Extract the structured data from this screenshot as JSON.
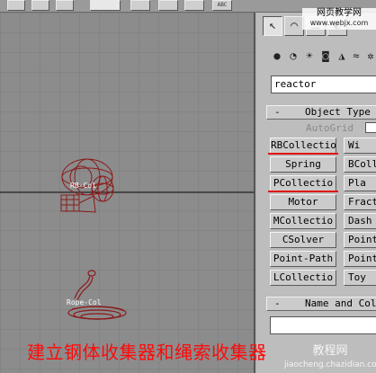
{
  "toolbar": {
    "abc_label": "ABC"
  },
  "panel": {
    "tabs": [
      {
        "icon": "create-icon",
        "glyph": "↖"
      },
      {
        "icon": "modify-icon",
        "glyph": "⌒"
      },
      {
        "icon": "hierarchy-icon",
        "glyph": "☰"
      },
      {
        "icon": "motion-icon",
        "glyph": "◐"
      }
    ],
    "categories": [
      {
        "icon": "geometry-icon",
        "glyph": "●"
      },
      {
        "icon": "shapes-icon",
        "glyph": "◔"
      },
      {
        "icon": "lights-icon",
        "glyph": "☀"
      },
      {
        "icon": "cameras-icon",
        "glyph": "◙"
      },
      {
        "icon": "helpers-icon",
        "glyph": "◮"
      },
      {
        "icon": "spacewarps-icon",
        "glyph": "≈"
      },
      {
        "icon": "systems-icon",
        "glyph": "✲"
      }
    ],
    "dropdown_value": "reactor",
    "object_type": {
      "sign": "-",
      "title": "Object Type",
      "autogrid": "AutoGrid"
    },
    "buttons_left": [
      "RBCollectio",
      "Spring",
      "PCollectio",
      "Motor",
      "MCollectio",
      "CSolver",
      "Point-Path",
      "LCollectio"
    ],
    "buttons_right": [
      "Wi",
      "BColl",
      "Pla",
      "Fract",
      "Dash",
      "Point",
      "Point-",
      "Toy"
    ],
    "name_color": {
      "sign": "-",
      "title": "Name and Colo"
    }
  },
  "viewport": {
    "labels": {
      "rb": "RB-Col",
      "rope": "Rope-Col"
    }
  },
  "caption": "建立钢体收集器和绳索收集器",
  "watermark_top": {
    "line1": "网页教学网",
    "line2": "www.webjx.com"
  },
  "watermark_bottom": {
    "line1": "教程网",
    "line2": "jiaocheng.chazidian.com"
  },
  "colors": {
    "annotation": "#e01010",
    "wireframe": "#8b1a1a",
    "caption": "#ff0a0a"
  }
}
